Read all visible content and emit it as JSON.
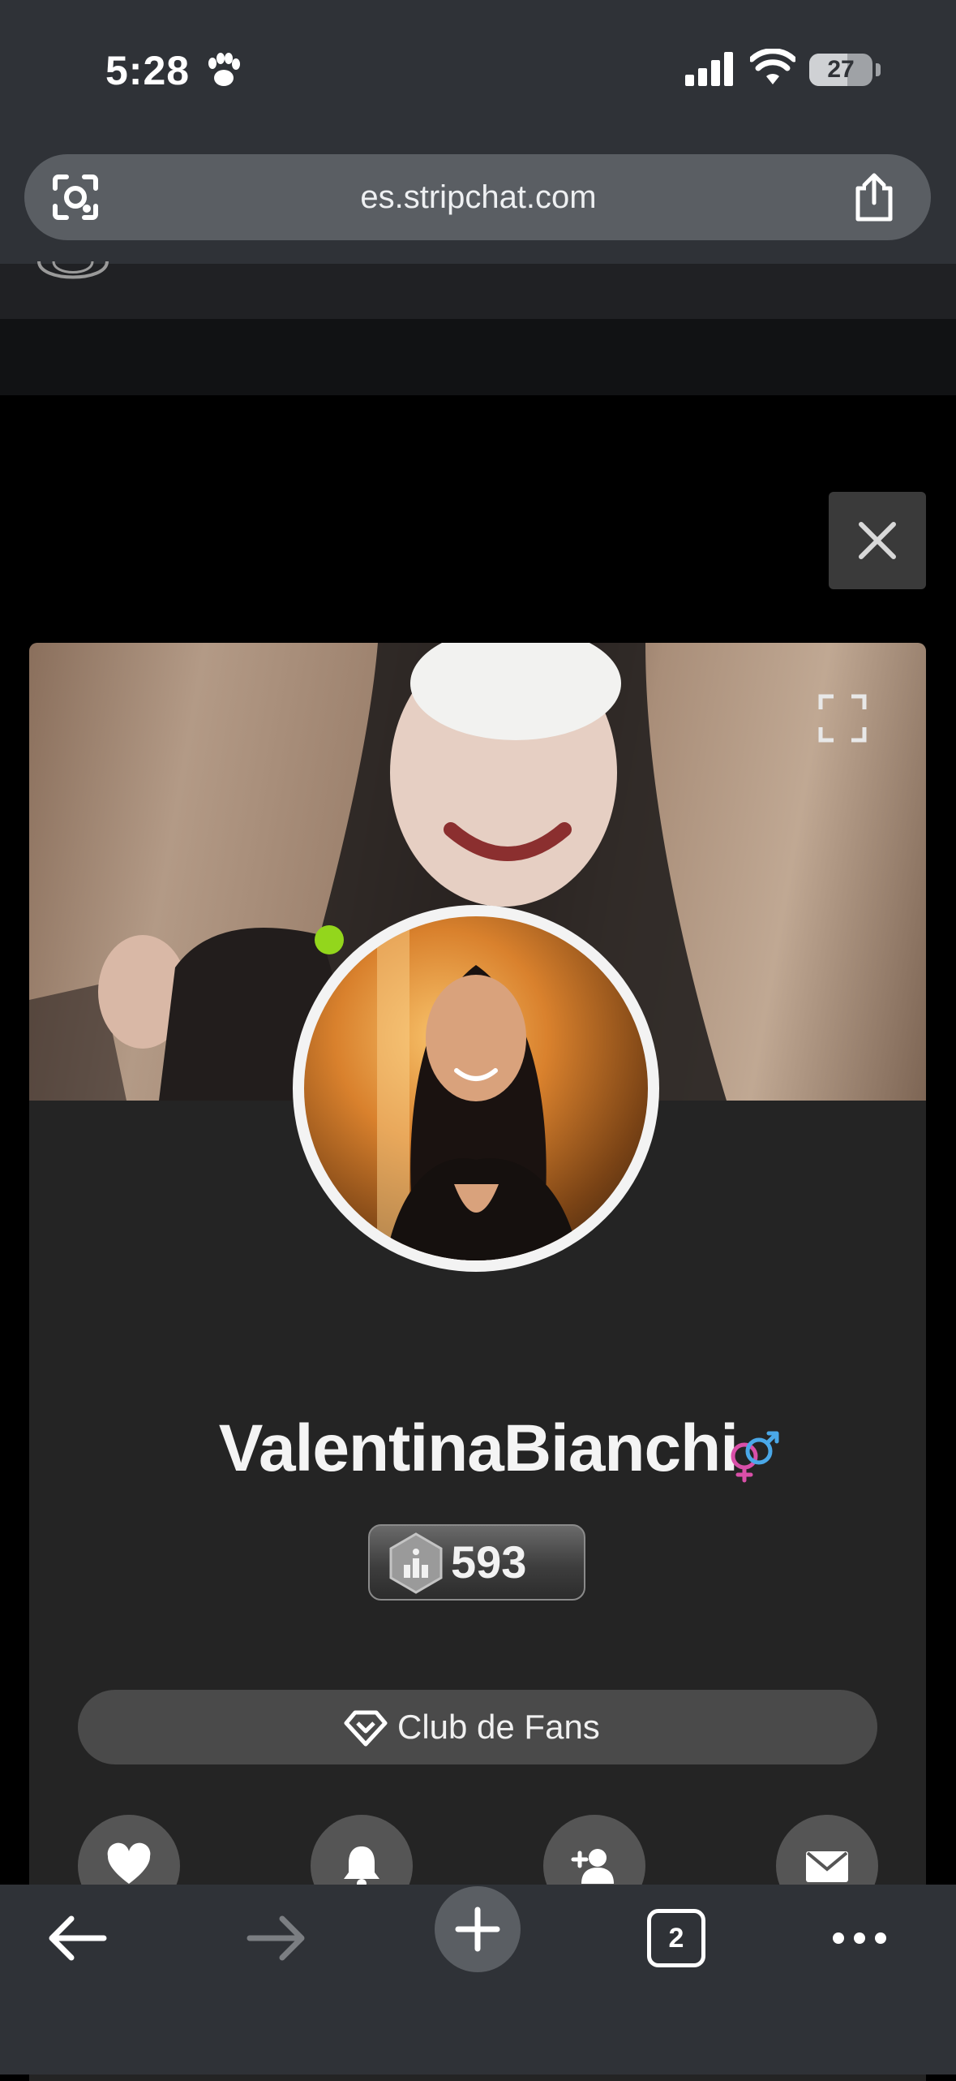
{
  "status_bar": {
    "time": "5:28",
    "battery": "27"
  },
  "browser": {
    "url": "es.stripchat.com",
    "tabs_count": "2"
  },
  "profile": {
    "username": "ValentinaBianchi",
    "level": "593",
    "fanclub_label": "Club de Fans",
    "online": true
  },
  "icons": {
    "paw": "paw-icon",
    "signal": "cellular-signal-icon",
    "wifi": "wifi-icon",
    "lens": "visual-search-icon",
    "share": "share-icon",
    "close": "close-icon",
    "expand": "fullscreen-icon",
    "gender": "gender-icon",
    "level": "level-badge-icon",
    "diamond": "diamond-icon",
    "heart": "heart-icon",
    "bell": "bell-icon",
    "add_user": "add-user-icon",
    "mail": "mail-icon",
    "back": "back-arrow-icon",
    "forward": "forward-arrow-icon",
    "new_tab": "plus-icon",
    "menu": "more-icon"
  },
  "colors": {
    "chrome_bg": "#2f3237",
    "card_bg": "#242424",
    "online_dot": "#93d61c",
    "gender_pink": "#d94fa8",
    "gender_blue": "#4aa8e8"
  }
}
